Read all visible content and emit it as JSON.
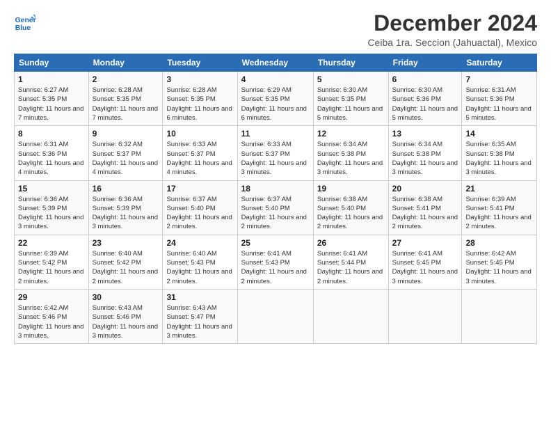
{
  "header": {
    "logo_line1": "General",
    "logo_line2": "Blue",
    "month_title": "December 2024",
    "location": "Ceiba 1ra. Seccion (Jahuactal), Mexico"
  },
  "columns": [
    "Sunday",
    "Monday",
    "Tuesday",
    "Wednesday",
    "Thursday",
    "Friday",
    "Saturday"
  ],
  "weeks": [
    [
      {
        "day": "1",
        "sunrise": "6:27 AM",
        "sunset": "5:35 PM",
        "daylight": "11 hours and 7 minutes."
      },
      {
        "day": "2",
        "sunrise": "6:28 AM",
        "sunset": "5:35 PM",
        "daylight": "11 hours and 7 minutes."
      },
      {
        "day": "3",
        "sunrise": "6:28 AM",
        "sunset": "5:35 PM",
        "daylight": "11 hours and 6 minutes."
      },
      {
        "day": "4",
        "sunrise": "6:29 AM",
        "sunset": "5:35 PM",
        "daylight": "11 hours and 6 minutes."
      },
      {
        "day": "5",
        "sunrise": "6:30 AM",
        "sunset": "5:35 PM",
        "daylight": "11 hours and 5 minutes."
      },
      {
        "day": "6",
        "sunrise": "6:30 AM",
        "sunset": "5:36 PM",
        "daylight": "11 hours and 5 minutes."
      },
      {
        "day": "7",
        "sunrise": "6:31 AM",
        "sunset": "5:36 PM",
        "daylight": "11 hours and 5 minutes."
      }
    ],
    [
      {
        "day": "8",
        "sunrise": "6:31 AM",
        "sunset": "5:36 PM",
        "daylight": "11 hours and 4 minutes."
      },
      {
        "day": "9",
        "sunrise": "6:32 AM",
        "sunset": "5:37 PM",
        "daylight": "11 hours and 4 minutes."
      },
      {
        "day": "10",
        "sunrise": "6:33 AM",
        "sunset": "5:37 PM",
        "daylight": "11 hours and 4 minutes."
      },
      {
        "day": "11",
        "sunrise": "6:33 AM",
        "sunset": "5:37 PM",
        "daylight": "11 hours and 3 minutes."
      },
      {
        "day": "12",
        "sunrise": "6:34 AM",
        "sunset": "5:38 PM",
        "daylight": "11 hours and 3 minutes."
      },
      {
        "day": "13",
        "sunrise": "6:34 AM",
        "sunset": "5:38 PM",
        "daylight": "11 hours and 3 minutes."
      },
      {
        "day": "14",
        "sunrise": "6:35 AM",
        "sunset": "5:38 PM",
        "daylight": "11 hours and 3 minutes."
      }
    ],
    [
      {
        "day": "15",
        "sunrise": "6:36 AM",
        "sunset": "5:39 PM",
        "daylight": "11 hours and 3 minutes."
      },
      {
        "day": "16",
        "sunrise": "6:36 AM",
        "sunset": "5:39 PM",
        "daylight": "11 hours and 3 minutes."
      },
      {
        "day": "17",
        "sunrise": "6:37 AM",
        "sunset": "5:40 PM",
        "daylight": "11 hours and 2 minutes."
      },
      {
        "day": "18",
        "sunrise": "6:37 AM",
        "sunset": "5:40 PM",
        "daylight": "11 hours and 2 minutes."
      },
      {
        "day": "19",
        "sunrise": "6:38 AM",
        "sunset": "5:40 PM",
        "daylight": "11 hours and 2 minutes."
      },
      {
        "day": "20",
        "sunrise": "6:38 AM",
        "sunset": "5:41 PM",
        "daylight": "11 hours and 2 minutes."
      },
      {
        "day": "21",
        "sunrise": "6:39 AM",
        "sunset": "5:41 PM",
        "daylight": "11 hours and 2 minutes."
      }
    ],
    [
      {
        "day": "22",
        "sunrise": "6:39 AM",
        "sunset": "5:42 PM",
        "daylight": "11 hours and 2 minutes."
      },
      {
        "day": "23",
        "sunrise": "6:40 AM",
        "sunset": "5:42 PM",
        "daylight": "11 hours and 2 minutes."
      },
      {
        "day": "24",
        "sunrise": "6:40 AM",
        "sunset": "5:43 PM",
        "daylight": "11 hours and 2 minutes."
      },
      {
        "day": "25",
        "sunrise": "6:41 AM",
        "sunset": "5:43 PM",
        "daylight": "11 hours and 2 minutes."
      },
      {
        "day": "26",
        "sunrise": "6:41 AM",
        "sunset": "5:44 PM",
        "daylight": "11 hours and 2 minutes."
      },
      {
        "day": "27",
        "sunrise": "6:41 AM",
        "sunset": "5:45 PM",
        "daylight": "11 hours and 3 minutes."
      },
      {
        "day": "28",
        "sunrise": "6:42 AM",
        "sunset": "5:45 PM",
        "daylight": "11 hours and 3 minutes."
      }
    ],
    [
      {
        "day": "29",
        "sunrise": "6:42 AM",
        "sunset": "5:46 PM",
        "daylight": "11 hours and 3 minutes."
      },
      {
        "day": "30",
        "sunrise": "6:43 AM",
        "sunset": "5:46 PM",
        "daylight": "11 hours and 3 minutes."
      },
      {
        "day": "31",
        "sunrise": "6:43 AM",
        "sunset": "5:47 PM",
        "daylight": "11 hours and 3 minutes."
      },
      null,
      null,
      null,
      null
    ]
  ]
}
